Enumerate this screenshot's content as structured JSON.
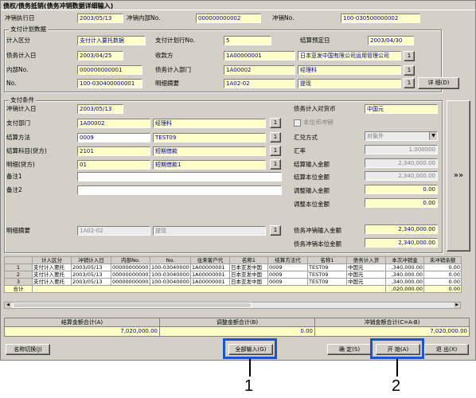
{
  "window": {
    "title": "债权/债务抵销(债务冲销数据详细输入)"
  },
  "header": {
    "exec_date_label": "冲销执行日",
    "exec_date": "2003/05/13",
    "internal_no_label": "冲销内部No.",
    "internal_no": "000000000002",
    "offset_no_label": "冲销No.",
    "offset_no": "100-030500000002"
  },
  "plan": {
    "group_label": "支付计划数据",
    "pay_class_label": "计入区分",
    "pay_class": "支付计入要托数据",
    "pay_line_label": "支付计划行No.",
    "pay_line": "5",
    "settle_date_label": "结算预定日",
    "settle_date": "2003/04/30",
    "debt_date_label": "债务计入日",
    "debt_date": "2003/04/25",
    "payee_label": "收款方",
    "payee_code": "1A00000001",
    "payee_name": "日本亚发中国有限公司运用管理公司",
    "inner_no_label": "内部No.",
    "inner_no": "000000000001",
    "debt_dept_label": "债务计入部门",
    "debt_dept_code": "1A00002",
    "debt_dept_name": "经理科",
    "no_label": "No.",
    "no": "100-030400000001",
    "detail_memo_label": "明细摘要",
    "detail_memo_code": "1A02-02",
    "detail_memo_name": "提现",
    "detail_btn": "详  细(D)"
  },
  "pay": {
    "group_label": "支付条件",
    "offset_date_label": "冲销计入日",
    "offset_date": "2003/05/13",
    "currency_label": "债务计入对货币",
    "currency": "中国元",
    "dept_label": "支付部门",
    "dept_code": "1A00002",
    "dept_name": "经理科",
    "local_offset_label": "本位币冲销",
    "method_label": "结算方法",
    "method_code": "0009",
    "method_name": "TEST09",
    "fx_label": "汇兑方式",
    "fx_value": "对象外",
    "subject_label": "结算科目(贷方)",
    "subject_code": "2101",
    "subject_name": "短期借款",
    "rate_label": "汇率",
    "rate": "1.000000",
    "detail_label": "明细(贷方)",
    "detail_code": "01",
    "detail_name": "短期借款1",
    "settle_in_label": "结算输入金额",
    "settle_in": "2,340,000.00",
    "memo1_label": "备注1",
    "settle_local_label": "结算本位金额",
    "settle_local": "2,340,000.00",
    "memo2_label": "备注2",
    "adj_in_label": "调整输入金额",
    "adj_in": "0.00",
    "adj_local_label": "调整本位金额",
    "adj_local": "0.00",
    "memo_label": "明细摘要",
    "memo_code": "1A02-02",
    "memo_name": "提现",
    "debt_in_label": "债务冲销输入金额",
    "debt_in": "2,340,000.00",
    "debt_local_label": "债务冲销本位金额",
    "debt_local": "2,340,000.00",
    "expand_btn": "»»",
    "lookup_btn": "1"
  },
  "grid": {
    "headers": [
      "计入区分",
      "冲销计入日",
      "内部No.",
      "No.",
      "往来客户代",
      "名称1",
      "结算方法代",
      "名称1",
      "债务计入货",
      "本次冲销金",
      "未冲销余额"
    ],
    "rows": [
      {
        "idx": "1",
        "cells": [
          "支付计入要托",
          "2003/05/13",
          "000000000001",
          "100-03040000",
          "1A00000001",
          "日本亚发中国",
          "0009",
          "TEST09",
          "中国元",
          ",340,000.00",
          "0.00"
        ]
      },
      {
        "idx": "2",
        "cells": [
          "支付计入要托",
          "2003/05/13",
          "000000000001",
          "100-03040000",
          "1A00000001",
          "日本亚发中国",
          "0009",
          "TEST09",
          "中国元",
          ",340,000.00",
          "0.00"
        ]
      },
      {
        "idx": "3",
        "cells": [
          "支付计入要托",
          "2003/05/13",
          "000000000001",
          "100-03040000",
          "1A00000001",
          "日本亚发中国",
          "0009",
          "TEST09",
          "中国元",
          ",340,000.00",
          "0.00"
        ]
      }
    ],
    "sum_label": "合计",
    "sum_value": ",020,000.00",
    "sum_rest": "0.00"
  },
  "totals": {
    "settle_label": "结算金额合计(A)",
    "settle": "7,020,000.00",
    "adj_label": "调整金额合计(B)",
    "adj": "0.00",
    "offset_label": "冲销金额合计(C=A-B)",
    "offset": "7,020,000.00"
  },
  "buttons": {
    "name_switch": "名称切换(J)",
    "all_input": "全部输入(G)",
    "confirm": "确  定(S)",
    "start": "开  始(A)",
    "exit": "退  出(X)"
  },
  "callouts": {
    "one": "1",
    "two": "2"
  },
  "colors": {
    "highlight": "#1c55c8",
    "yellow_field": "#ffffc8",
    "window_bg": "#d4d0c8"
  }
}
